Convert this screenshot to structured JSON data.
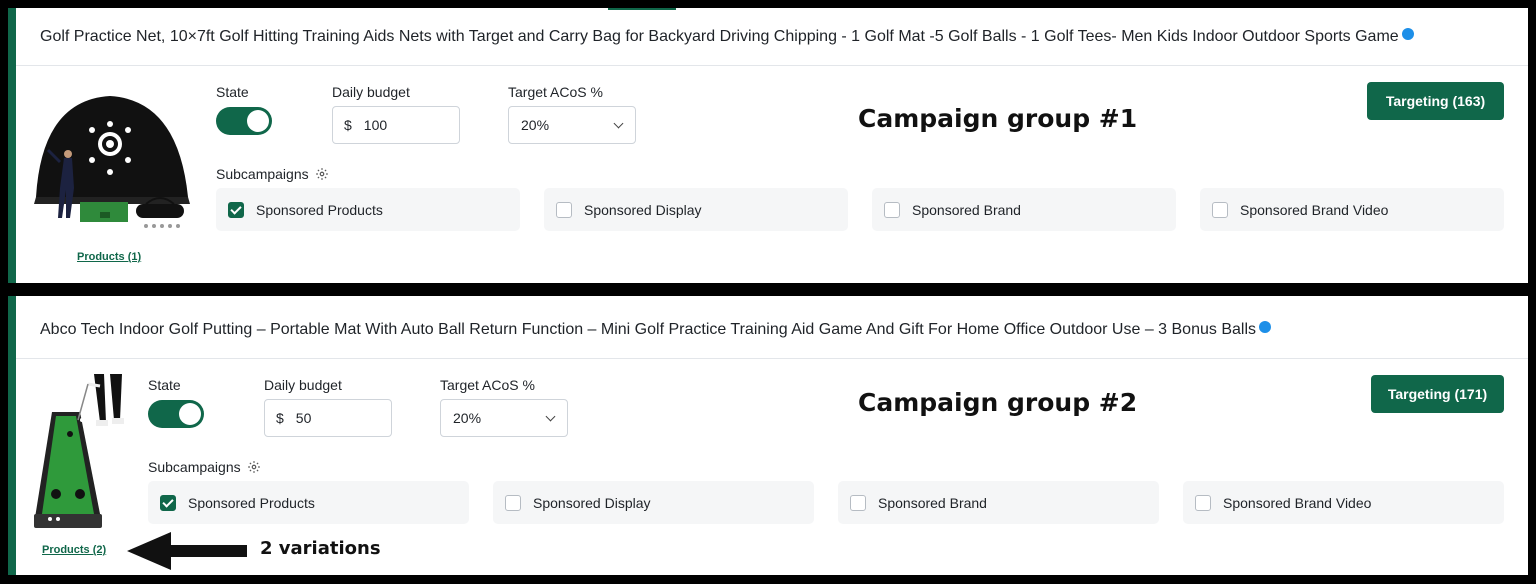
{
  "campaigns": [
    {
      "title": "Golf Practice Net, 10×7ft Golf Hitting Training Aids Nets with Target and Carry Bag for Backyard Driving Chipping - 1 Golf Mat -5 Golf Balls - 1 Golf Tees- Men Kids Indoor Outdoor Sports Game",
      "state_label": "State",
      "state_on": true,
      "budget_label": "Daily budget",
      "currency": "$",
      "budget_value": "100",
      "acos_label": "Target ACoS %",
      "acos_value": "20%",
      "group_label": "Campaign group #1",
      "targeting_button": "Targeting (163)",
      "subcampaigns_label": "Subcampaigns",
      "subcampaigns": [
        {
          "label": "Sponsored Products",
          "checked": true
        },
        {
          "label": "Sponsored Display",
          "checked": false
        },
        {
          "label": "Sponsored Brand",
          "checked": false
        },
        {
          "label": "Sponsored Brand Video",
          "checked": false
        }
      ],
      "products_link": "Products (1)",
      "thumbnail_icon": "golf-net-image"
    },
    {
      "title": "Abco Tech Indoor Golf Putting – Portable Mat With Auto Ball Return Function – Mini Golf Practice Training Aid Game And Gift For Home Office Outdoor Use – 3 Bonus Balls",
      "state_label": "State",
      "state_on": true,
      "budget_label": "Daily budget",
      "currency": "$",
      "budget_value": "50",
      "acos_label": "Target ACoS %",
      "acos_value": "20%",
      "group_label": "Campaign group #2",
      "targeting_button": "Targeting (171)",
      "subcampaigns_label": "Subcampaigns",
      "subcampaigns": [
        {
          "label": "Sponsored Products",
          "checked": true
        },
        {
          "label": "Sponsored Display",
          "checked": false
        },
        {
          "label": "Sponsored Brand",
          "checked": false
        },
        {
          "label": "Sponsored Brand Video",
          "checked": false
        }
      ],
      "products_link": "Products (2)",
      "thumbnail_icon": "putting-mat-image"
    }
  ],
  "annotation": {
    "text": "2 variations",
    "icon": "arrow-left-icon"
  },
  "colors": {
    "accent": "#10674a",
    "status_dot": "#1d8fe8",
    "subcampaign_bg": "#f5f6f7"
  }
}
